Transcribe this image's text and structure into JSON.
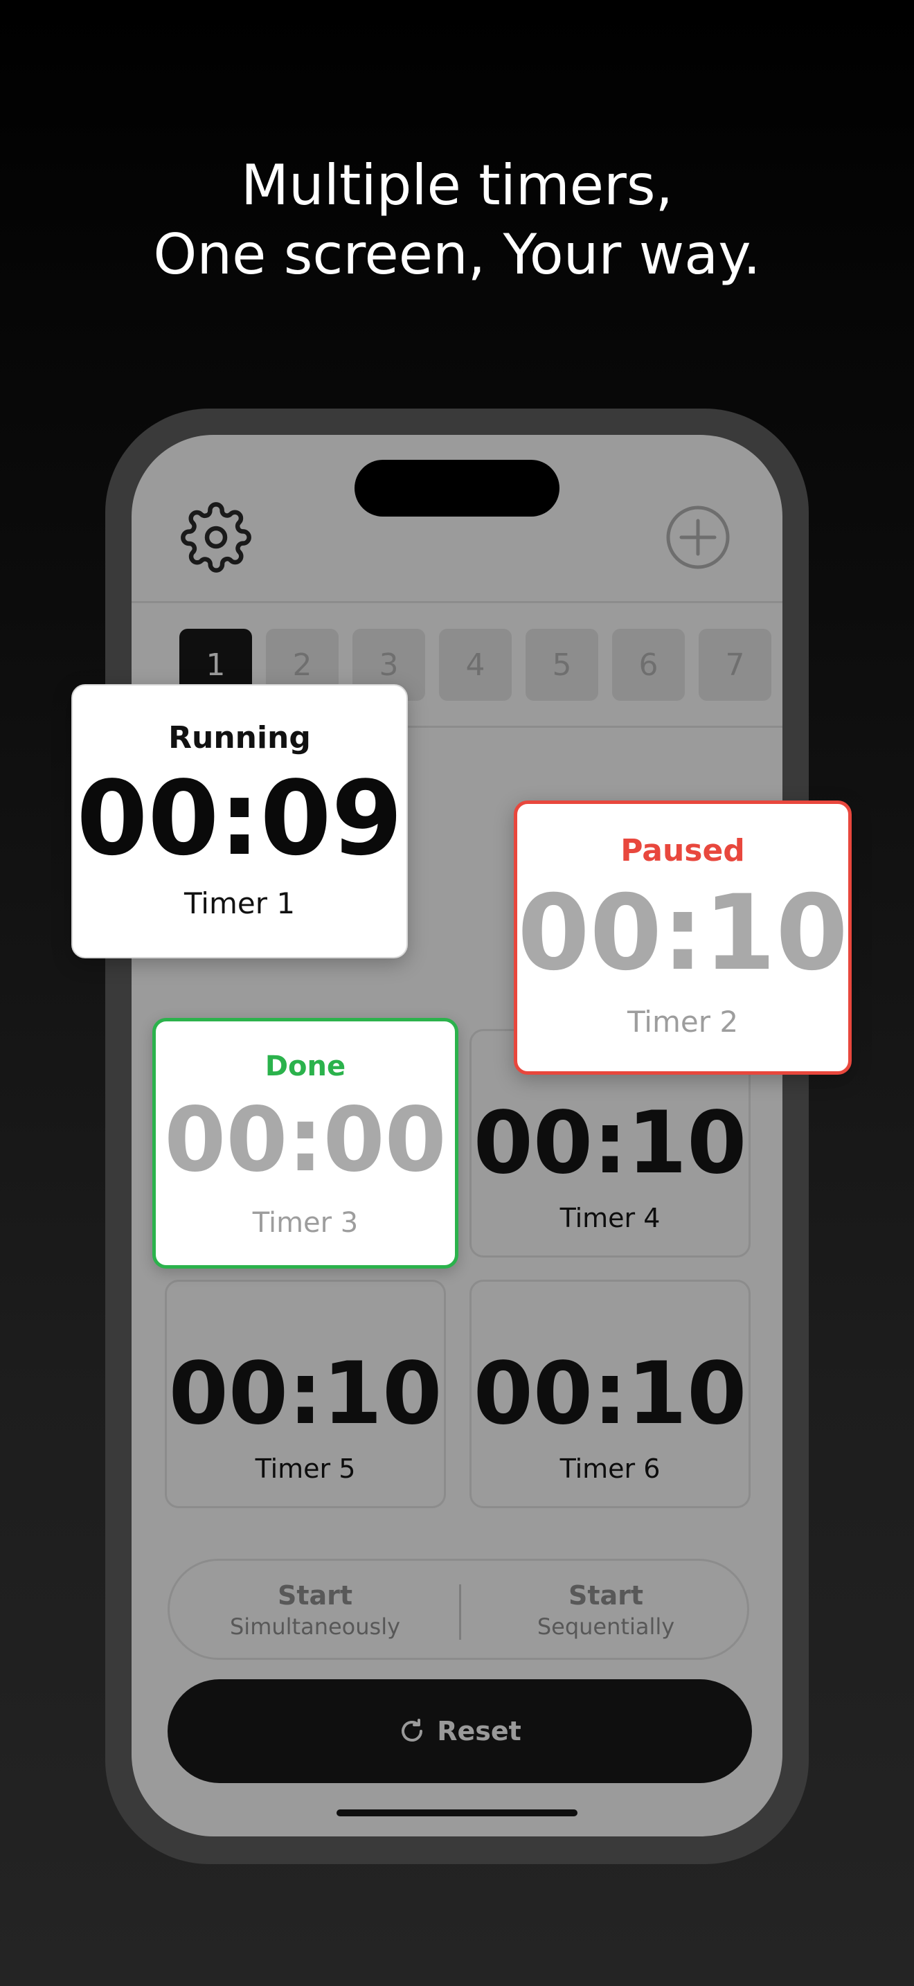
{
  "headline": {
    "line1": "Multiple timers,",
    "line2": "One screen, Your way."
  },
  "toolbar": {
    "settings_icon": "gear-icon",
    "add_icon": "plus-circle-icon"
  },
  "tabs": [
    {
      "label": "1",
      "active": true
    },
    {
      "label": "2",
      "active": false
    },
    {
      "label": "3",
      "active": false
    },
    {
      "label": "4",
      "active": false
    },
    {
      "label": "5",
      "active": false
    },
    {
      "label": "6",
      "active": false
    },
    {
      "label": "7",
      "active": false
    }
  ],
  "timers": {
    "t1": {
      "status": "Running",
      "time": "00:09",
      "name": "Timer 1"
    },
    "t2": {
      "status": "Paused",
      "time": "00:10",
      "name": "Timer 2"
    },
    "t3": {
      "status": "Done",
      "time": "00:00",
      "name": "Timer 3"
    },
    "t4": {
      "time": "00:10",
      "name": "Timer 4"
    },
    "t5": {
      "time": "00:10",
      "name": "Timer 5"
    },
    "t6": {
      "time": "00:10",
      "name": "Timer 6"
    }
  },
  "controls": {
    "start_simultaneous_title": "Start",
    "start_simultaneous_sub": "Simultaneously",
    "start_sequential_title": "Start",
    "start_sequential_sub": "Sequentially",
    "reset_label": "Reset",
    "reset_icon": "refresh-icon"
  },
  "colors": {
    "running": "#111111",
    "paused": "#e8473d",
    "done": "#2bb24c",
    "screen_dim": "#9b9b9b"
  }
}
